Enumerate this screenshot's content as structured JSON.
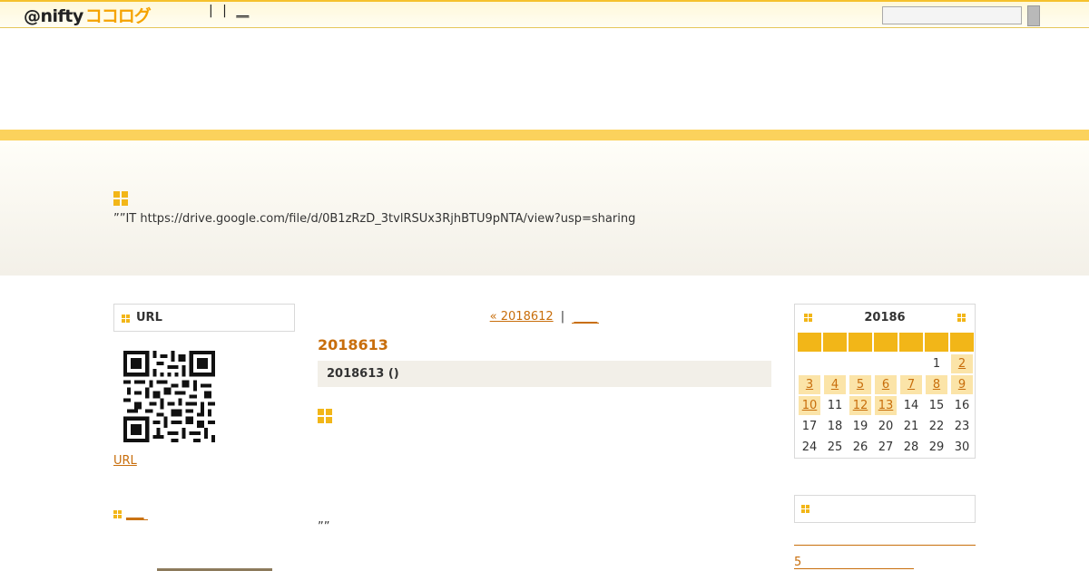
{
  "topbar": {
    "logo_at": "@nifty",
    "logo_koko": "ココログ",
    "links": [
      "|",
      "|",
      "__"
    ],
    "search_placeholder": ""
  },
  "header": {
    "description": "””IT  https://drive.google.com/file/d/0B1zRzD_3tvlRSUx3RjhBTU9pNTA/view?usp=sharing"
  },
  "left_sidebar": {
    "url_box_title": "URL",
    "url_link": "URL",
    "section_link": "___"
  },
  "main": {
    "prev_link": "« 2018612",
    "separator": "|",
    "next_link": "____",
    "date_title": "2018613",
    "entry_head": "2018613 ()",
    "entry_quote": "””"
  },
  "calendar": {
    "month_label": "20186",
    "weeks": [
      [
        {
          "d": ""
        },
        {
          "d": ""
        },
        {
          "d": ""
        },
        {
          "d": ""
        },
        {
          "d": ""
        },
        {
          "d": "1"
        },
        {
          "d": "2",
          "link": true
        }
      ],
      [
        {
          "d": "3",
          "link": true
        },
        {
          "d": "4",
          "link": true
        },
        {
          "d": "5",
          "link": true
        },
        {
          "d": "6",
          "link": true
        },
        {
          "d": "7",
          "link": true
        },
        {
          "d": "8",
          "link": true
        },
        {
          "d": "9",
          "link": true
        }
      ],
      [
        {
          "d": "10",
          "link": true
        },
        {
          "d": "11"
        },
        {
          "d": "12",
          "link": true
        },
        {
          "d": "13",
          "link": true
        },
        {
          "d": "14"
        },
        {
          "d": "15"
        },
        {
          "d": "16"
        }
      ],
      [
        {
          "d": "17"
        },
        {
          "d": "18"
        },
        {
          "d": "19"
        },
        {
          "d": "20"
        },
        {
          "d": "21"
        },
        {
          "d": "22"
        },
        {
          "d": "23"
        }
      ],
      [
        {
          "d": "24"
        },
        {
          "d": "25"
        },
        {
          "d": "26"
        },
        {
          "d": "27"
        },
        {
          "d": "28"
        },
        {
          "d": "29"
        },
        {
          "d": "30"
        }
      ]
    ],
    "accent_color": "#f2b618",
    "link_bg_color": "#fbe4a8"
  },
  "right_sidebar": {
    "recent_link": "5"
  },
  "colors": {
    "link": "#c86e0c",
    "stripe": "#fbd25c",
    "icon": "#f2b618"
  }
}
